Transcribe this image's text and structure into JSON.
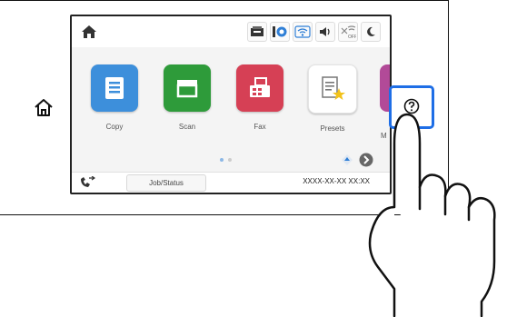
{
  "panel": {
    "hardware_home_icon": "home-outline-icon",
    "help_button_icon": "question-circle-icon"
  },
  "screen": {
    "statusbar": {
      "home_icon": "home-filled-icon",
      "status_icons": [
        "maintenance-icon",
        "io-wifi-direct-icon",
        "wifi-icon",
        "volume-icon",
        "network-off-icon",
        "night-mode-icon"
      ]
    },
    "tiles": [
      {
        "label": "Copy",
        "icon": "copy-icon",
        "color": "#3d8fdb"
      },
      {
        "label": "Scan",
        "icon": "scan-icon",
        "color": "#2e9b3a"
      },
      {
        "label": "Fax",
        "icon": "fax-icon",
        "color": "#d64055"
      },
      {
        "label": "Presets",
        "icon": "presets-star-icon",
        "color": "#ffffff"
      }
    ],
    "partial_tile_label": "M",
    "bottom": {
      "job_status_label": "Job/Status",
      "datetime": "XXXX-XX-XX XX:XX"
    }
  },
  "colors": {
    "help_highlight": "#1e6ee6"
  }
}
